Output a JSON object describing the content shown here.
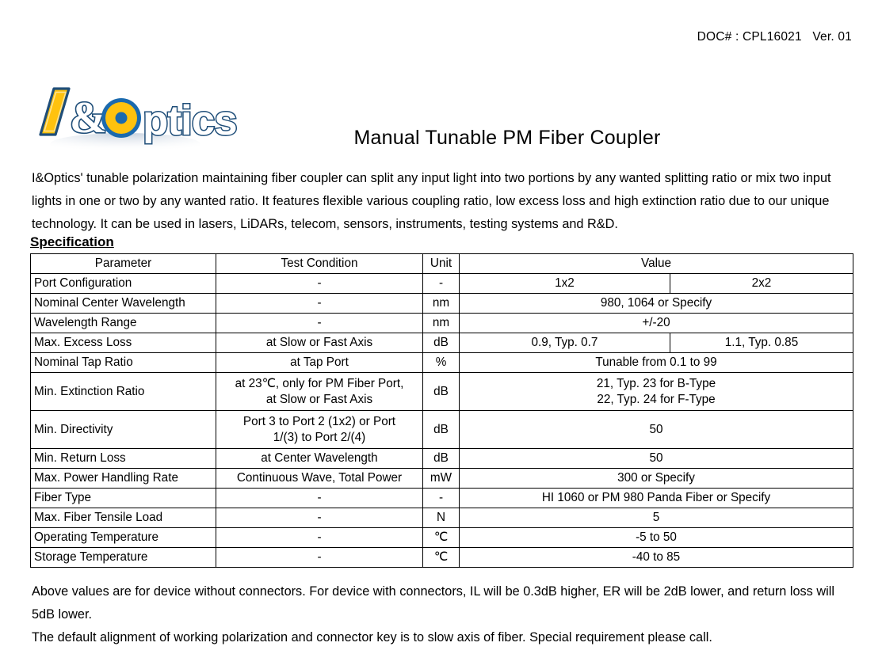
{
  "header": {
    "doc_code": "DOC# : CPL16021   Ver. 01"
  },
  "logo": {
    "name": "iandoptics-logo",
    "text": "I&Optics",
    "colors": {
      "yellow": "#FFC20E",
      "blue": "#1B6AAE",
      "dark_blue": "#1F4E79",
      "white": "#FFFFFF"
    }
  },
  "title": "Manual Tunable PM Fiber Coupler",
  "intro": "I&Optics' tunable polarization maintaining fiber coupler can split any input light into two portions by any wanted splitting ratio or mix two input lights in one or two by any wanted ratio. It features flexible various coupling ratio, low excess loss and high extinction ratio due to our unique technology. It can be used in lasers, LiDARs, telecom, sensors, instruments, testing systems and R&D.",
  "spec_heading": "Specification",
  "table": {
    "headers": {
      "parameter": "Parameter",
      "test_condition": "Test Condition",
      "unit": "Unit",
      "value": "Value"
    },
    "rows": [
      {
        "parameter": "Port Configuration",
        "condition": "-",
        "unit": "-",
        "value1": "1x2",
        "value2": "2x2",
        "split": true
      },
      {
        "parameter": "Nominal Center Wavelength",
        "condition": "-",
        "unit": "nm",
        "value": "980, 1064 or Specify",
        "split": false
      },
      {
        "parameter": "Wavelength Range",
        "condition": "-",
        "unit": "nm",
        "value": "+/-20",
        "split": false
      },
      {
        "parameter": "Max. Excess Loss",
        "condition": "at Slow or Fast Axis",
        "unit": "dB",
        "value1": "0.9, Typ. 0.7",
        "value2": "1.1, Typ. 0.85",
        "split": true
      },
      {
        "parameter": "Nominal Tap Ratio",
        "condition": "at Tap Port",
        "unit": "%",
        "value": "Tunable from 0.1 to 99",
        "split": false
      },
      {
        "parameter": "Min. Extinction Ratio",
        "condition_line1": "at 23℃, only for PM Fiber Port,",
        "condition_line2": "at Slow or Fast Axis",
        "unit": "dB",
        "value_line1": "21, Typ. 23 for B-Type",
        "value_line2": "22, Typ. 24 for F-Type",
        "split": false,
        "tall": true
      },
      {
        "parameter": "Min. Directivity",
        "condition_line1": "Port 3 to Port 2 (1x2) or Port",
        "condition_line2": "1/(3) to Port 2/(4)",
        "unit": "dB",
        "value": "50",
        "split": false,
        "tall": true
      },
      {
        "parameter": "Min. Return Loss",
        "condition": "at Center Wavelength",
        "unit": "dB",
        "value": "50",
        "split": false
      },
      {
        "parameter": "Max. Power Handling Rate",
        "condition": "Continuous Wave, Total Power",
        "unit": "mW",
        "value": "300 or Specify",
        "split": false
      },
      {
        "parameter": "Fiber Type",
        "condition": "-",
        "unit": "-",
        "value": "HI 1060 or PM 980 Panda Fiber or Specify",
        "split": false
      },
      {
        "parameter": "Max. Fiber Tensile Load",
        "condition": "-",
        "unit": "N",
        "value": "5",
        "split": false
      },
      {
        "parameter": "Operating Temperature",
        "condition": "-",
        "unit": "℃",
        "value": "-5 to 50",
        "split": false
      },
      {
        "parameter": "Storage Temperature",
        "condition": "-",
        "unit": "℃",
        "value": "-40 to 85",
        "split": false
      }
    ]
  },
  "notes": {
    "note1": "Above values are for device without connectors. For device with connectors, IL will be 0.3dB higher, ER will be 2dB lower, and return loss will 5dB lower.",
    "note2": "The default alignment of working polarization and connector key is to slow axis of fiber. Special requirement please call."
  }
}
